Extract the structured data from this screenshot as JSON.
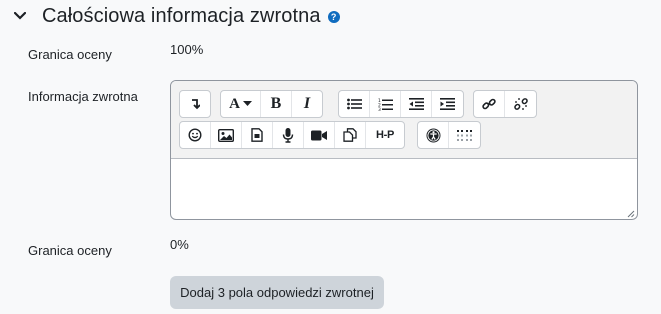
{
  "section": {
    "title": "Całościowa informacja zwrotna",
    "help_icon": "question-circle-icon",
    "toggle_icon": "chevron-down-icon"
  },
  "grade_boundary_1": {
    "label": "Granica oceny",
    "value": "100%"
  },
  "feedback": {
    "label": "Informacja zwrotna",
    "value": ""
  },
  "grade_boundary_2": {
    "label": "Granica oceny",
    "value": "0%"
  },
  "add_button": {
    "label": "Dodaj 3 pola odpowiedzi zwrotnej"
  },
  "toolbar": {
    "font_icon": "A",
    "bold": "B",
    "italic": "I",
    "h5p": "H-P",
    "icons_row1": [
      "collapse-toolbar-icon",
      "font-style-icon",
      "bold-icon",
      "italic-icon",
      "unordered-list-icon",
      "ordered-list-icon",
      "outdent-icon",
      "indent-icon",
      "link-icon",
      "unlink-icon"
    ],
    "icons_row2": [
      "emoji-icon",
      "image-icon",
      "media-icon",
      "record-audio-icon",
      "record-video-icon",
      "manage-files-icon",
      "h5p-icon",
      "accessibility-checker-icon",
      "screenreader-helper-icon"
    ]
  },
  "colors": {
    "background": "#f8f9fa",
    "help_icon": "#0f6cbf",
    "button_bg": "#ced4da",
    "toolbar_bg": "#f2f2f2"
  }
}
